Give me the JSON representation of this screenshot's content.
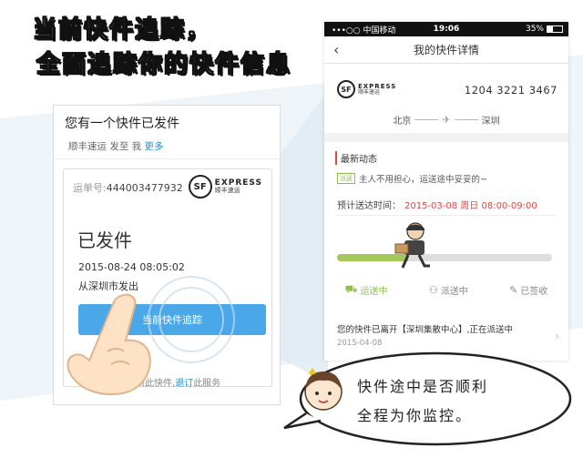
{
  "headline": {
    "line1": "当前快件追踪，",
    "line2": "全面追踪你的快件信息"
  },
  "card": {
    "title": "您有一个快件已发件",
    "sub_sender": "顺丰速运 发至 我",
    "sub_more": "更多",
    "waybill_label": "运单号:",
    "waybill_number": "444003477932",
    "logo_en": "EXPRESS",
    "logo_cn": "顺丰速运",
    "logo_mark": "SF",
    "status": "已发件",
    "time": "2015-08-24  08:05:02",
    "from": "从深圳市发出",
    "track_button": "当前快件追踪",
    "footer_prefix": "不想收到此快件,",
    "footer_link": "退订",
    "footer_suffix": "此服务"
  },
  "phone": {
    "carrier": "•••○○ 中国移动",
    "time": "19:06",
    "battery": "35%",
    "battery_level": 0.35,
    "title": "我的快件详情",
    "tracking_number": "1204 3221 3467",
    "route_from": "北京",
    "route_to": "深圳",
    "news_title": "最新动态",
    "news_badge": "派送",
    "news_text": "主人不用担心，运送途中妥妥的~",
    "eta_label": "预计送达时间：",
    "eta_value": "2015-03-08 周日 08:00-09:00",
    "progress": 0.33,
    "stages": [
      "运送中",
      "派送中",
      "已签收"
    ],
    "stage_icons": [
      "delivery-icon",
      "courier-icon",
      "signed-icon"
    ],
    "message": "您的快件已离开【深圳集散中心】,正在派送中",
    "message_date": "2015-04-08"
  },
  "bubble": {
    "line1": "快件途中是否顺利",
    "line2": "全程为你监控。"
  },
  "colors": {
    "accent_blue": "#4aa8e8",
    "progress_green": "#a6c85a",
    "alert_red": "#e04848"
  }
}
